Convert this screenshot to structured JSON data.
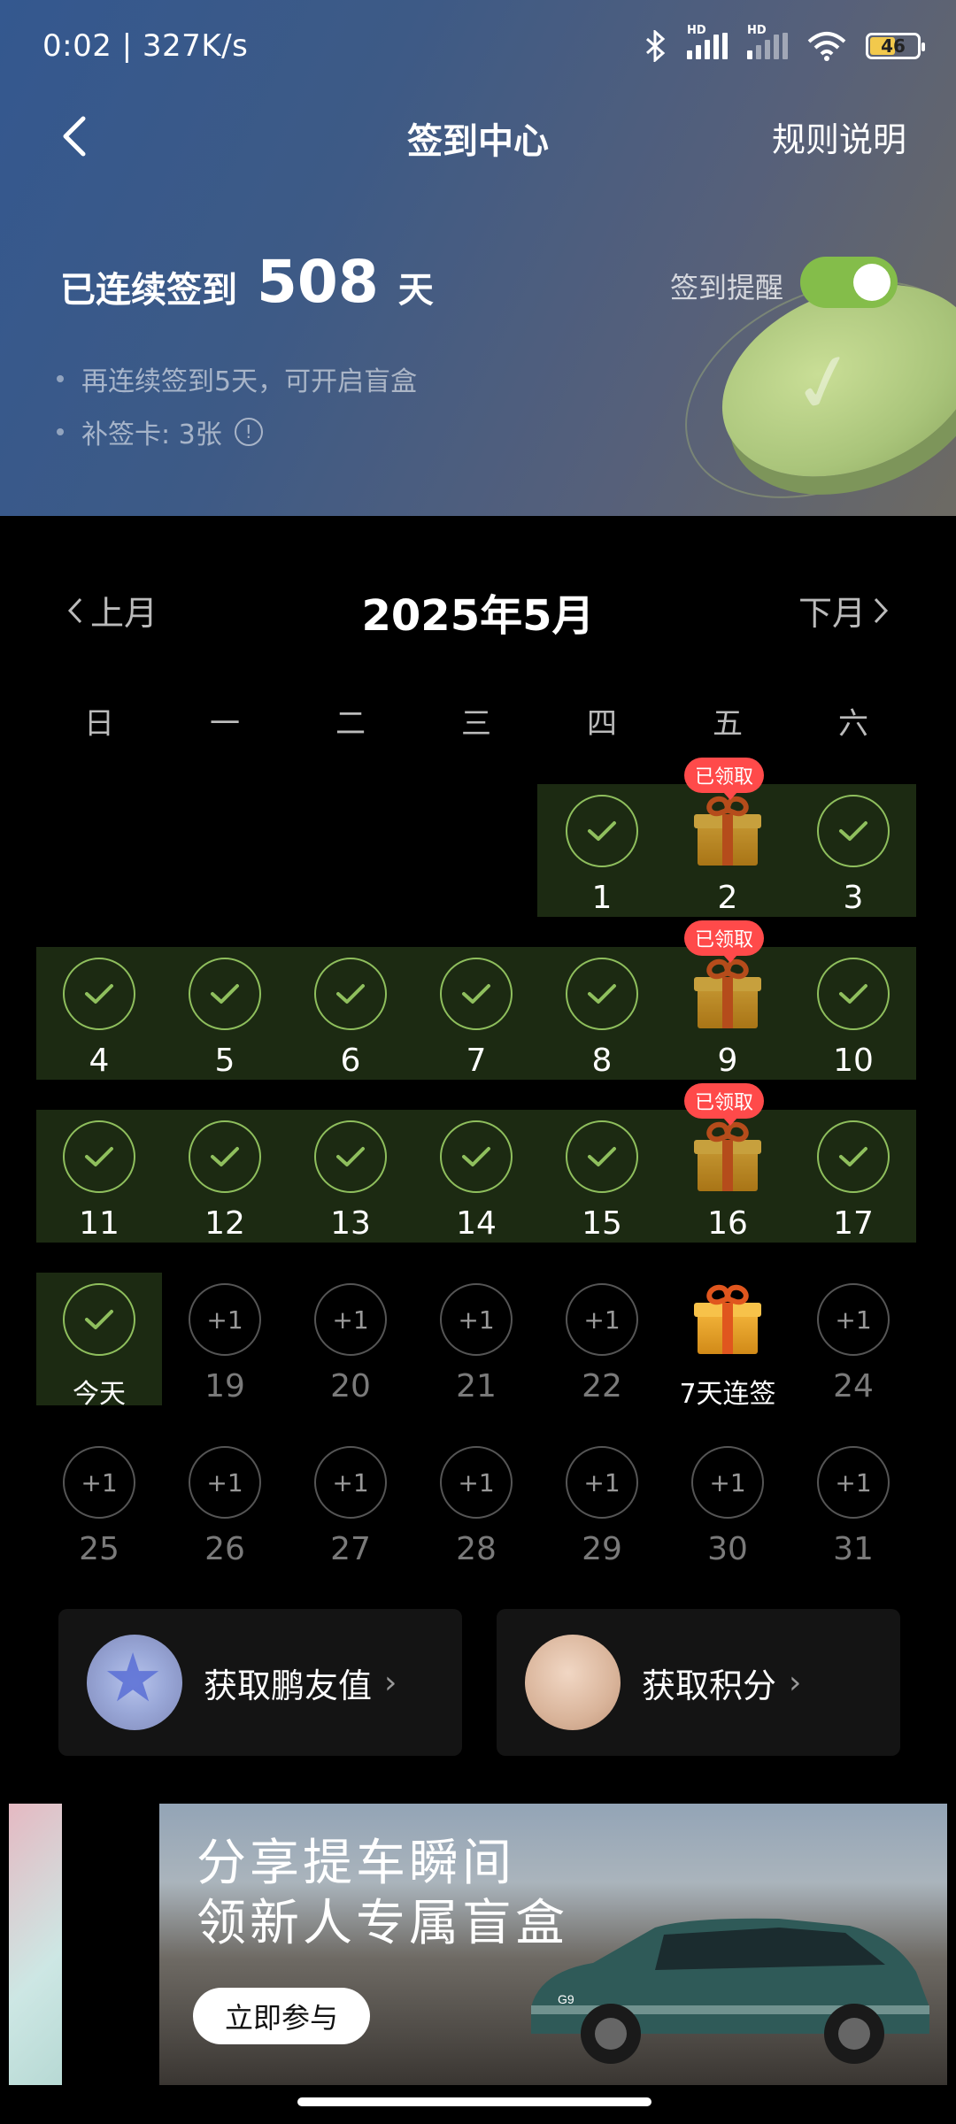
{
  "status_bar": {
    "time": "0:02 | 327K/s",
    "hd1": "HD",
    "hd2": "HD",
    "battery": "46"
  },
  "nav": {
    "back": "back-icon",
    "title": "签到中心",
    "rules": "规则说明"
  },
  "streak": {
    "prefix": "已连续签到",
    "days": "508",
    "suffix": "天"
  },
  "notes": [
    "再连续签到5天，可开启盲盒",
    "补签卡: 3张"
  ],
  "reminder": {
    "label": "签到提醒",
    "enabled": true
  },
  "calendar": {
    "prev": "上月",
    "next": "下月",
    "title": "2025年5月",
    "weekdays": [
      "日",
      "一",
      "二",
      "三",
      "四",
      "五",
      "六"
    ],
    "claimed_label": "已领取",
    "plus_label": "+1",
    "today_label": "今天",
    "streak7_label": "7天连签",
    "days": [
      {
        "label": "1",
        "state": "checked"
      },
      {
        "label": "2",
        "state": "gift-claimed"
      },
      {
        "label": "3",
        "state": "checked"
      },
      {
        "label": "4",
        "state": "checked"
      },
      {
        "label": "5",
        "state": "checked"
      },
      {
        "label": "6",
        "state": "checked"
      },
      {
        "label": "7",
        "state": "checked"
      },
      {
        "label": "8",
        "state": "checked"
      },
      {
        "label": "9",
        "state": "gift-claimed"
      },
      {
        "label": "10",
        "state": "checked"
      },
      {
        "label": "11",
        "state": "checked"
      },
      {
        "label": "12",
        "state": "checked"
      },
      {
        "label": "13",
        "state": "checked"
      },
      {
        "label": "14",
        "state": "checked"
      },
      {
        "label": "15",
        "state": "checked"
      },
      {
        "label": "16",
        "state": "gift-claimed"
      },
      {
        "label": "17",
        "state": "checked"
      },
      {
        "label": "今天",
        "state": "today"
      },
      {
        "label": "19",
        "state": "future"
      },
      {
        "label": "20",
        "state": "future"
      },
      {
        "label": "21",
        "state": "future"
      },
      {
        "label": "22",
        "state": "future"
      },
      {
        "label": "7天连签",
        "state": "gift-future"
      },
      {
        "label": "24",
        "state": "future"
      },
      {
        "label": "25",
        "state": "future"
      },
      {
        "label": "26",
        "state": "future"
      },
      {
        "label": "27",
        "state": "future"
      },
      {
        "label": "28",
        "state": "future"
      },
      {
        "label": "29",
        "state": "future"
      },
      {
        "label": "30",
        "state": "future"
      },
      {
        "label": "31",
        "state": "future"
      }
    ]
  },
  "cards": [
    {
      "label": "获取鹏友值",
      "icon": "star-avatar-icon"
    },
    {
      "label": "获取积分",
      "icon": "coin-avatar-icon"
    }
  ],
  "banner": {
    "line1": "分享提车瞬间",
    "line2": "领新人专属盲盒",
    "cta": "立即参与",
    "car_badge": "G9"
  },
  "colors": {
    "accent_green": "#84bd4a",
    "badge_red": "#ff4a4a",
    "week_bg": "#1c2a12"
  }
}
